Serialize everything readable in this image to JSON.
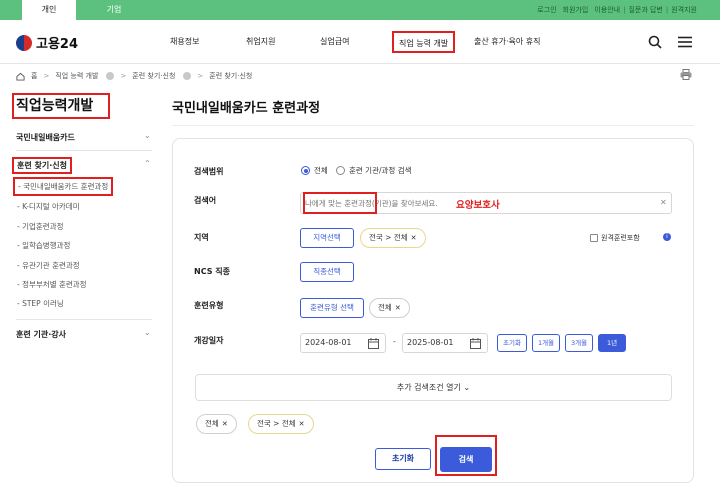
{
  "topbar": {
    "tabs": [
      "개인",
      "기업"
    ],
    "utility": [
      "로그인",
      "회원가입",
      "이용안내",
      "질문과 답변",
      "원격지원"
    ]
  },
  "header": {
    "logo": "고용24",
    "nav": [
      "채용정보",
      "취업지원",
      "실업급여",
      "직업 능력 개발",
      "출산 휴가·육아 휴직"
    ]
  },
  "breadcrumb": [
    "홈",
    "직업 능력 개발",
    "훈련 찾기·신청",
    "훈련 찾기·신청"
  ],
  "sidebar": {
    "title": "직업능력개발",
    "sections": [
      {
        "label": "국민내일배움카드"
      },
      {
        "label": "훈련 찾기·신청"
      },
      {
        "label": "훈련 기관·강사"
      }
    ],
    "sub_items": [
      "- 국민내일배움카드 훈련과정",
      "- K-디지털 아카데미",
      "- 기업훈련과정",
      "- 일학습병행과정",
      "- 유관기관 훈련과정",
      "- 정부부처별 훈련과정",
      "- STEP 이러닝"
    ]
  },
  "main": {
    "title": "국민내일배움카드 훈련과정",
    "form": {
      "scope": {
        "label": "검색범위",
        "options": [
          "전체",
          "훈련 기관/과정 검색"
        ]
      },
      "keyword": {
        "label": "검색어",
        "placeholder": "나에게 맞는 훈련과정(기관)을 찾아보세요.",
        "value": "요양보호사"
      },
      "region": {
        "label": "지역",
        "button": "지역선택",
        "chip": "전국 > 전체",
        "checkbox": "원격훈련포함"
      },
      "ncs": {
        "label": "NCS 직종",
        "button": "직종선택"
      },
      "type": {
        "label": "훈련유형",
        "button": "훈련유형 선택",
        "chip": "전체"
      },
      "date": {
        "label": "개강일자",
        "start": "2024-08-01",
        "end": "2025-08-01",
        "separator": "-",
        "periods": [
          "초기화",
          "1개월",
          "3개월",
          "1년"
        ],
        "active_period": "1년"
      },
      "more_conditions": "추가 검색조건 열기",
      "selected_chips": [
        "전체",
        "전국 > 전체"
      ],
      "reset_button": "초기화",
      "search_button": "검색"
    }
  },
  "colors": {
    "brand_green": "#5cc17e",
    "accent_blue": "#3b5bdb",
    "highlight_red": "#e02020"
  }
}
